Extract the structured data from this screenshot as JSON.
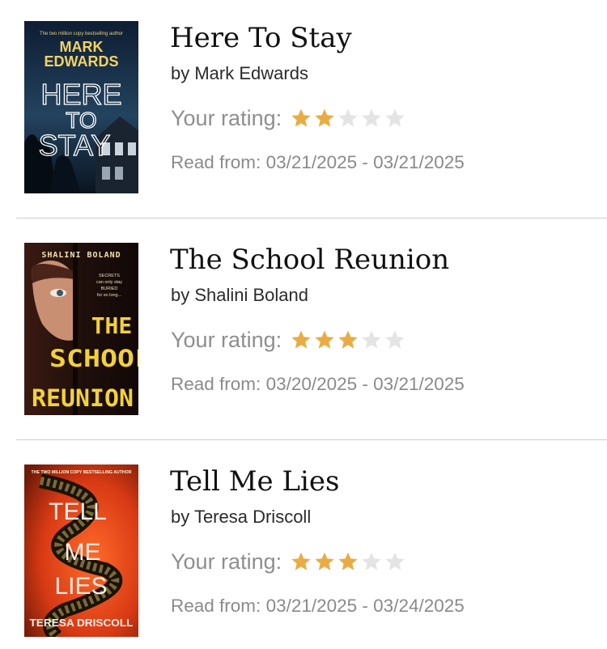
{
  "rating_label": "Your rating:",
  "read_label": "Read from:",
  "colors": {
    "star_filled": "#E9AC45",
    "star_empty": "#E4E4E4"
  },
  "books": [
    {
      "title": "Here To Stay",
      "author": "by Mark Edwards",
      "rating": 2,
      "max_rating": 5,
      "read_dates": "03/21/2025 - 03/21/2025",
      "cover": {
        "tagline": "The two million copy bestselling author",
        "author_line1": "MARK",
        "author_line2": "EDWARDS",
        "title_lines": [
          "HERE",
          "TO",
          "STAY"
        ]
      }
    },
    {
      "title": "The School Reunion",
      "author": "by Shalini Boland",
      "rating": 3,
      "max_rating": 5,
      "read_dates": "03/20/2025 - 03/21/2025",
      "cover": {
        "author_line": "SHALINI BOLAND",
        "tagline_lines": [
          "SECRETS",
          "can only stay",
          "BURIED",
          "for so long..."
        ],
        "title_lines": [
          "THE",
          "SCHOOL",
          "REUNION"
        ]
      }
    },
    {
      "title": "Tell Me Lies",
      "author": "by Teresa Driscoll",
      "rating": 3,
      "max_rating": 5,
      "read_dates": "03/21/2025 - 03/24/2025",
      "cover": {
        "tagline": "THE TWO MILLION COPY BESTSELLING AUTHOR",
        "title_lines": [
          "TELL",
          "ME",
          "LIES"
        ],
        "author_line": "TERESA DRISCOLL"
      }
    }
  ]
}
